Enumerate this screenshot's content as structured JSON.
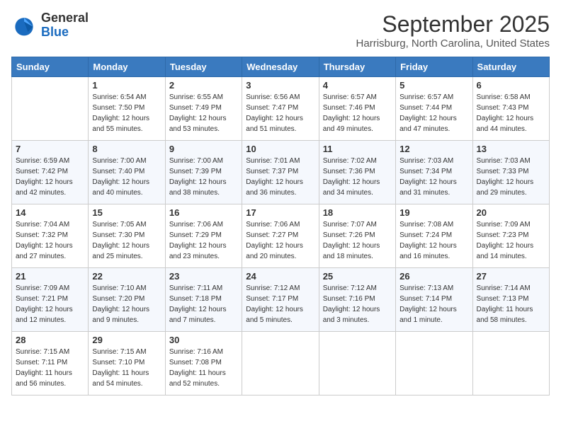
{
  "header": {
    "logo": {
      "general": "General",
      "blue": "Blue"
    },
    "title": "September 2025",
    "location": "Harrisburg, North Carolina, United States"
  },
  "weekdays": [
    "Sunday",
    "Monday",
    "Tuesday",
    "Wednesday",
    "Thursday",
    "Friday",
    "Saturday"
  ],
  "weeks": [
    [
      {
        "day": "",
        "info": ""
      },
      {
        "day": "1",
        "info": "Sunrise: 6:54 AM\nSunset: 7:50 PM\nDaylight: 12 hours\nand 55 minutes."
      },
      {
        "day": "2",
        "info": "Sunrise: 6:55 AM\nSunset: 7:49 PM\nDaylight: 12 hours\nand 53 minutes."
      },
      {
        "day": "3",
        "info": "Sunrise: 6:56 AM\nSunset: 7:47 PM\nDaylight: 12 hours\nand 51 minutes."
      },
      {
        "day": "4",
        "info": "Sunrise: 6:57 AM\nSunset: 7:46 PM\nDaylight: 12 hours\nand 49 minutes."
      },
      {
        "day": "5",
        "info": "Sunrise: 6:57 AM\nSunset: 7:44 PM\nDaylight: 12 hours\nand 47 minutes."
      },
      {
        "day": "6",
        "info": "Sunrise: 6:58 AM\nSunset: 7:43 PM\nDaylight: 12 hours\nand 44 minutes."
      }
    ],
    [
      {
        "day": "7",
        "info": "Sunrise: 6:59 AM\nSunset: 7:42 PM\nDaylight: 12 hours\nand 42 minutes."
      },
      {
        "day": "8",
        "info": "Sunrise: 7:00 AM\nSunset: 7:40 PM\nDaylight: 12 hours\nand 40 minutes."
      },
      {
        "day": "9",
        "info": "Sunrise: 7:00 AM\nSunset: 7:39 PM\nDaylight: 12 hours\nand 38 minutes."
      },
      {
        "day": "10",
        "info": "Sunrise: 7:01 AM\nSunset: 7:37 PM\nDaylight: 12 hours\nand 36 minutes."
      },
      {
        "day": "11",
        "info": "Sunrise: 7:02 AM\nSunset: 7:36 PM\nDaylight: 12 hours\nand 34 minutes."
      },
      {
        "day": "12",
        "info": "Sunrise: 7:03 AM\nSunset: 7:34 PM\nDaylight: 12 hours\nand 31 minutes."
      },
      {
        "day": "13",
        "info": "Sunrise: 7:03 AM\nSunset: 7:33 PM\nDaylight: 12 hours\nand 29 minutes."
      }
    ],
    [
      {
        "day": "14",
        "info": "Sunrise: 7:04 AM\nSunset: 7:32 PM\nDaylight: 12 hours\nand 27 minutes."
      },
      {
        "day": "15",
        "info": "Sunrise: 7:05 AM\nSunset: 7:30 PM\nDaylight: 12 hours\nand 25 minutes."
      },
      {
        "day": "16",
        "info": "Sunrise: 7:06 AM\nSunset: 7:29 PM\nDaylight: 12 hours\nand 23 minutes."
      },
      {
        "day": "17",
        "info": "Sunrise: 7:06 AM\nSunset: 7:27 PM\nDaylight: 12 hours\nand 20 minutes."
      },
      {
        "day": "18",
        "info": "Sunrise: 7:07 AM\nSunset: 7:26 PM\nDaylight: 12 hours\nand 18 minutes."
      },
      {
        "day": "19",
        "info": "Sunrise: 7:08 AM\nSunset: 7:24 PM\nDaylight: 12 hours\nand 16 minutes."
      },
      {
        "day": "20",
        "info": "Sunrise: 7:09 AM\nSunset: 7:23 PM\nDaylight: 12 hours\nand 14 minutes."
      }
    ],
    [
      {
        "day": "21",
        "info": "Sunrise: 7:09 AM\nSunset: 7:21 PM\nDaylight: 12 hours\nand 12 minutes."
      },
      {
        "day": "22",
        "info": "Sunrise: 7:10 AM\nSunset: 7:20 PM\nDaylight: 12 hours\nand 9 minutes."
      },
      {
        "day": "23",
        "info": "Sunrise: 7:11 AM\nSunset: 7:18 PM\nDaylight: 12 hours\nand 7 minutes."
      },
      {
        "day": "24",
        "info": "Sunrise: 7:12 AM\nSunset: 7:17 PM\nDaylight: 12 hours\nand 5 minutes."
      },
      {
        "day": "25",
        "info": "Sunrise: 7:12 AM\nSunset: 7:16 PM\nDaylight: 12 hours\nand 3 minutes."
      },
      {
        "day": "26",
        "info": "Sunrise: 7:13 AM\nSunset: 7:14 PM\nDaylight: 12 hours\nand 1 minute."
      },
      {
        "day": "27",
        "info": "Sunrise: 7:14 AM\nSunset: 7:13 PM\nDaylight: 11 hours\nand 58 minutes."
      }
    ],
    [
      {
        "day": "28",
        "info": "Sunrise: 7:15 AM\nSunset: 7:11 PM\nDaylight: 11 hours\nand 56 minutes."
      },
      {
        "day": "29",
        "info": "Sunrise: 7:15 AM\nSunset: 7:10 PM\nDaylight: 11 hours\nand 54 minutes."
      },
      {
        "day": "30",
        "info": "Sunrise: 7:16 AM\nSunset: 7:08 PM\nDaylight: 11 hours\nand 52 minutes."
      },
      {
        "day": "",
        "info": ""
      },
      {
        "day": "",
        "info": ""
      },
      {
        "day": "",
        "info": ""
      },
      {
        "day": "",
        "info": ""
      }
    ]
  ]
}
